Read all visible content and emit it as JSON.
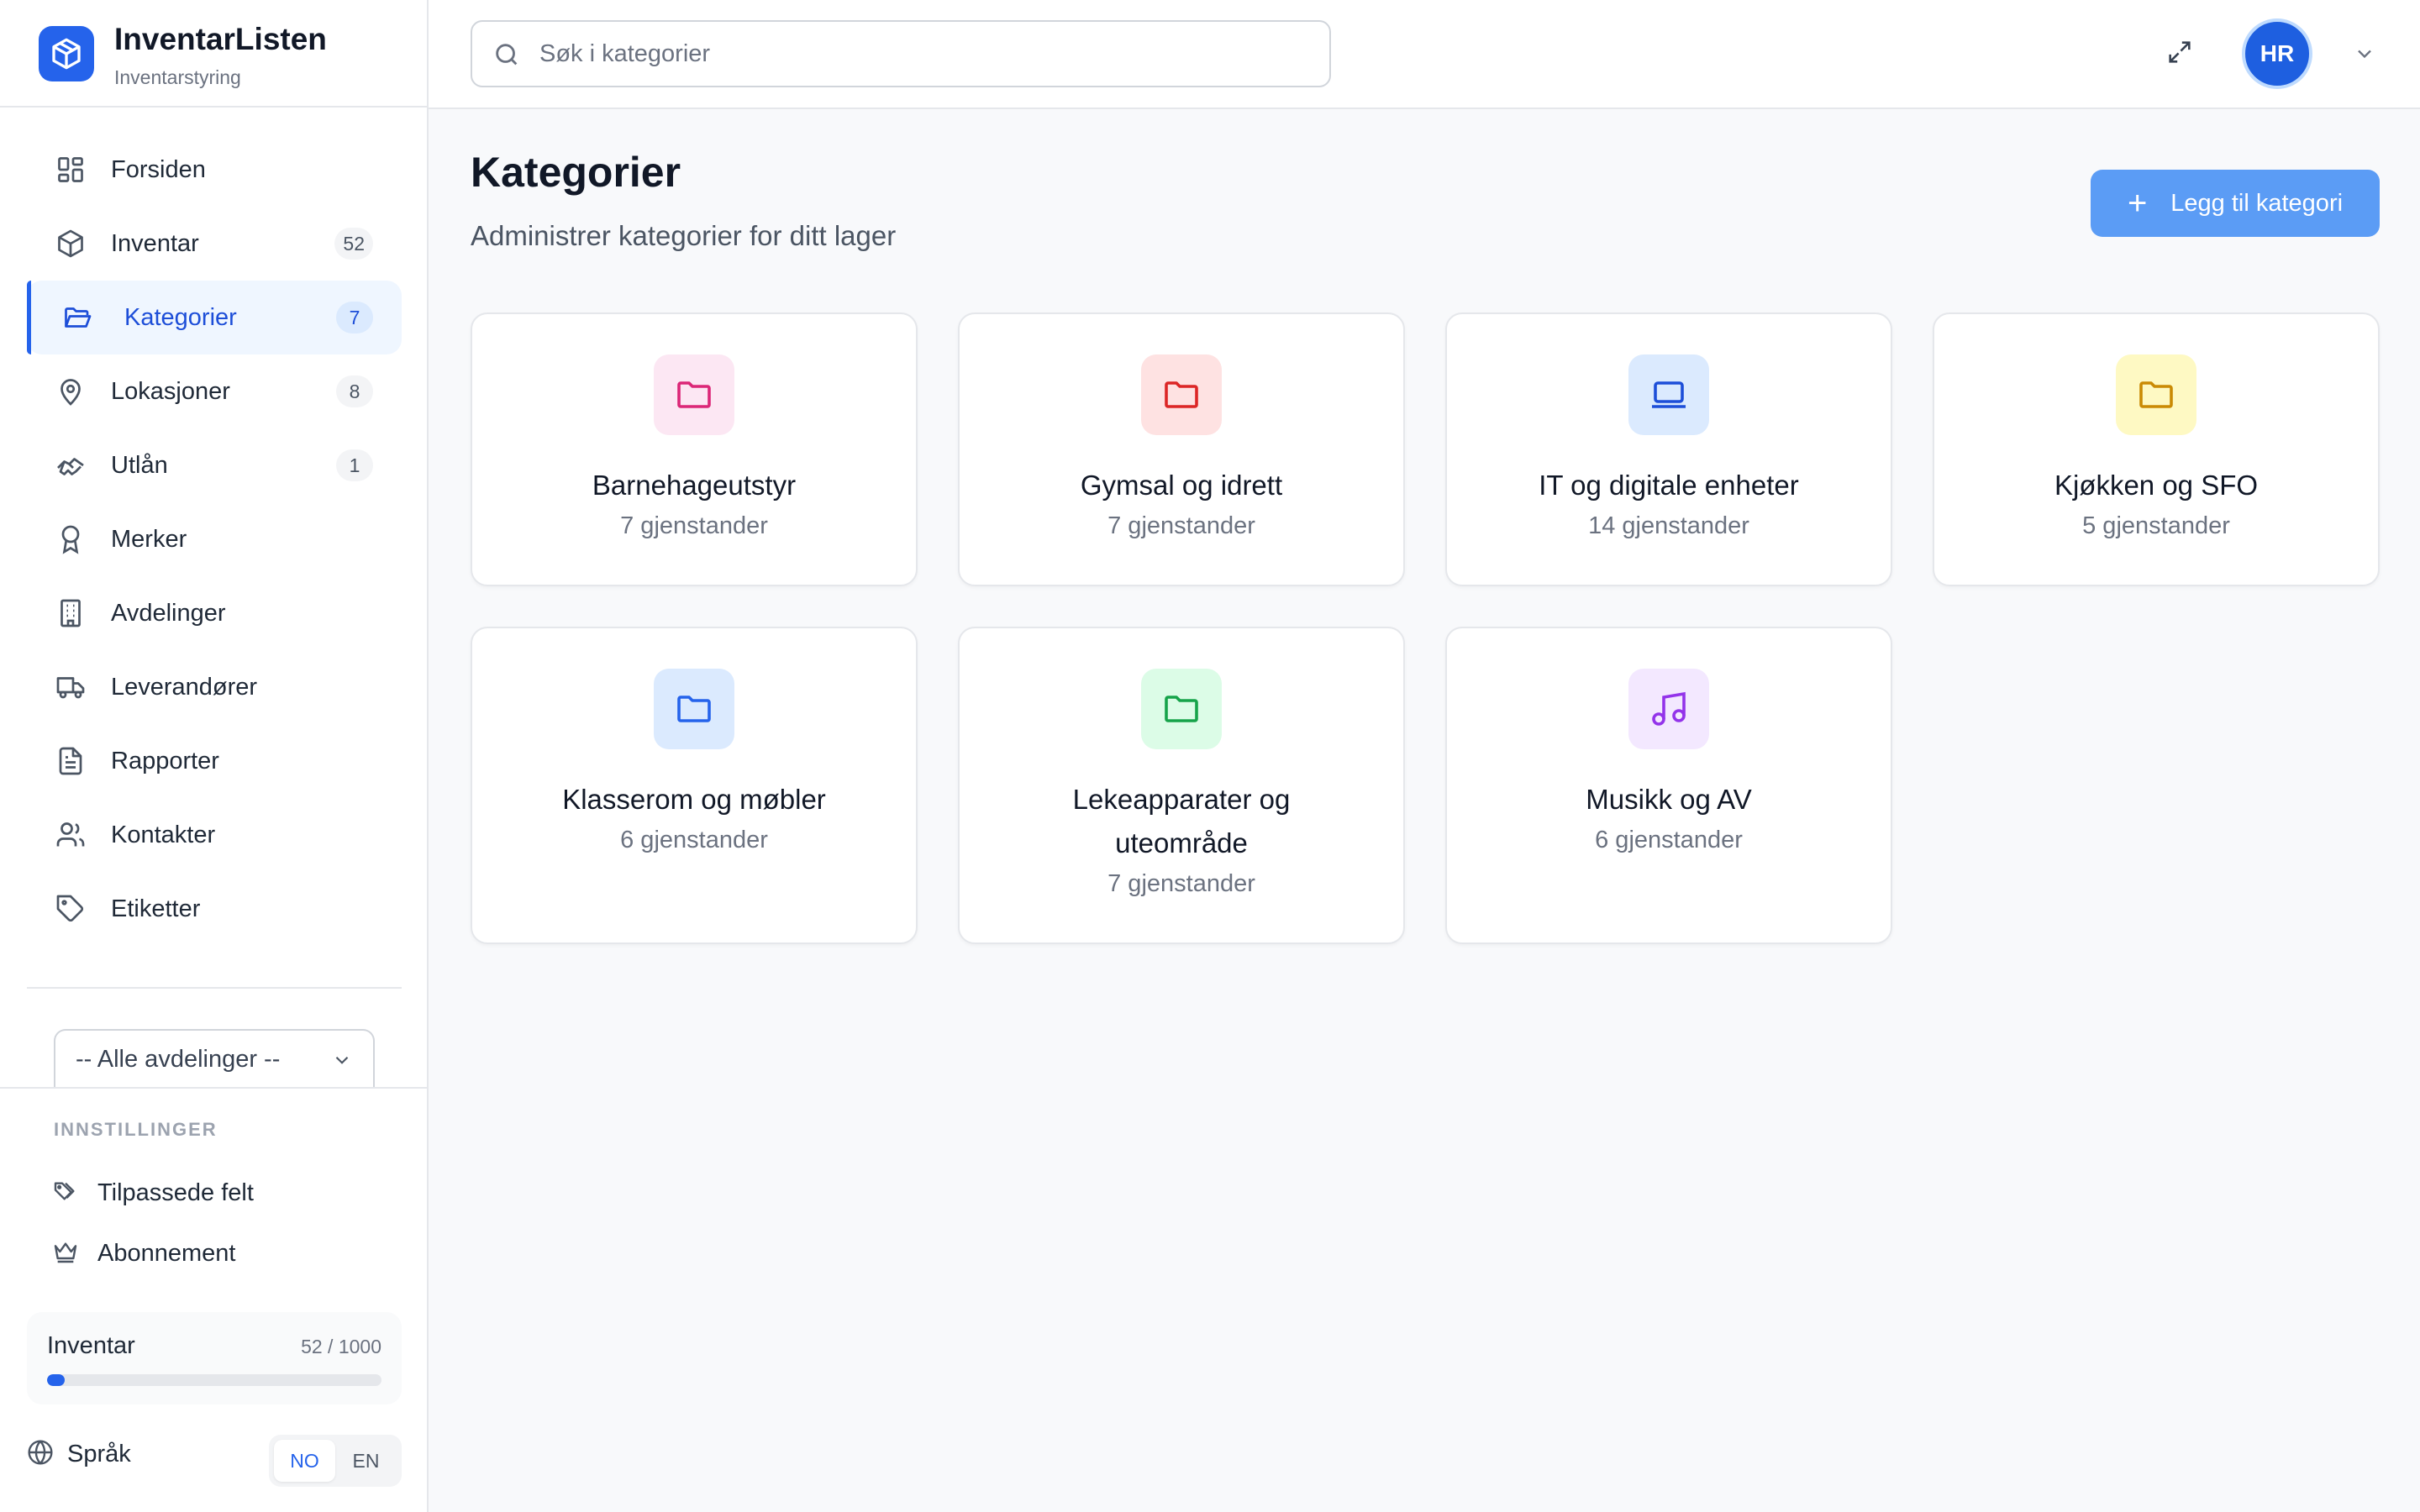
{
  "brand": {
    "name": "InventarListen",
    "subtitle": "Inventarstyring"
  },
  "nav": [
    {
      "label": "Forsiden",
      "icon": "grid-icon",
      "badge": null
    },
    {
      "label": "Inventar",
      "icon": "box-icon",
      "badge": "52"
    },
    {
      "label": "Kategorier",
      "icon": "folder-open-icon",
      "badge": "7",
      "active": true
    },
    {
      "label": "Lokasjoner",
      "icon": "map-pin-icon",
      "badge": "8"
    },
    {
      "label": "Utlån",
      "icon": "handshake-icon",
      "badge": "1"
    },
    {
      "label": "Merker",
      "icon": "award-icon",
      "badge": null
    },
    {
      "label": "Avdelinger",
      "icon": "building-icon",
      "badge": null
    },
    {
      "label": "Leverandører",
      "icon": "truck-icon",
      "badge": null
    },
    {
      "label": "Rapporter",
      "icon": "file-text-icon",
      "badge": null
    },
    {
      "label": "Kontakter",
      "icon": "users-icon",
      "badge": null
    },
    {
      "label": "Etiketter",
      "icon": "tag-icon",
      "badge": null
    }
  ],
  "department_select": {
    "value": "-- Alle avdelinger --"
  },
  "settings": {
    "title": "INNSTILLINGER",
    "items": [
      {
        "label": "Tilpassede felt",
        "icon": "tags-icon"
      },
      {
        "label": "Abonnement",
        "icon": "crown-icon"
      }
    ]
  },
  "usage": {
    "label": "Inventar",
    "count": "52 / 1000",
    "fraction": 0.052
  },
  "language": {
    "label": "Språk",
    "options": [
      "NO",
      "EN"
    ],
    "selected": "NO"
  },
  "search": {
    "placeholder": "Søk i kategorier"
  },
  "user": {
    "initials": "HR"
  },
  "page": {
    "title": "Kategorier",
    "subtitle": "Administrer kategorier for ditt lager",
    "add_button": "Legg til kategori"
  },
  "categories": [
    {
      "title": "Barnehageutstyr",
      "count": "7 gjenstander",
      "icon": "folder-icon",
      "color": "#db2777",
      "bg": "#fce7f3"
    },
    {
      "title": "Gymsal og idrett",
      "count": "7 gjenstander",
      "icon": "folder-icon",
      "color": "#dc2626",
      "bg": "#fee2e2"
    },
    {
      "title": "IT og digitale enheter",
      "count": "14 gjenstander",
      "icon": "laptop-icon",
      "color": "#1d4ed8",
      "bg": "#dbeafe"
    },
    {
      "title": "Kjøkken og SFO",
      "count": "5 gjenstander",
      "icon": "folder-icon",
      "color": "#ca8a04",
      "bg": "#fef9c3"
    },
    {
      "title": "Klasserom og møbler",
      "count": "6 gjenstander",
      "icon": "folder-icon",
      "color": "#2563eb",
      "bg": "#dbeafe"
    },
    {
      "title": "Lekeapparater og uteområde",
      "count": "7 gjenstander",
      "icon": "folder-icon",
      "color": "#16a34a",
      "bg": "#dcfce7"
    },
    {
      "title": "Musikk og AV",
      "count": "6 gjenstander",
      "icon": "music-icon",
      "color": "#9333ea",
      "bg": "#f3e8ff"
    }
  ],
  "colors": {
    "accent": "#2563eb",
    "button": "#5b9cf5"
  }
}
